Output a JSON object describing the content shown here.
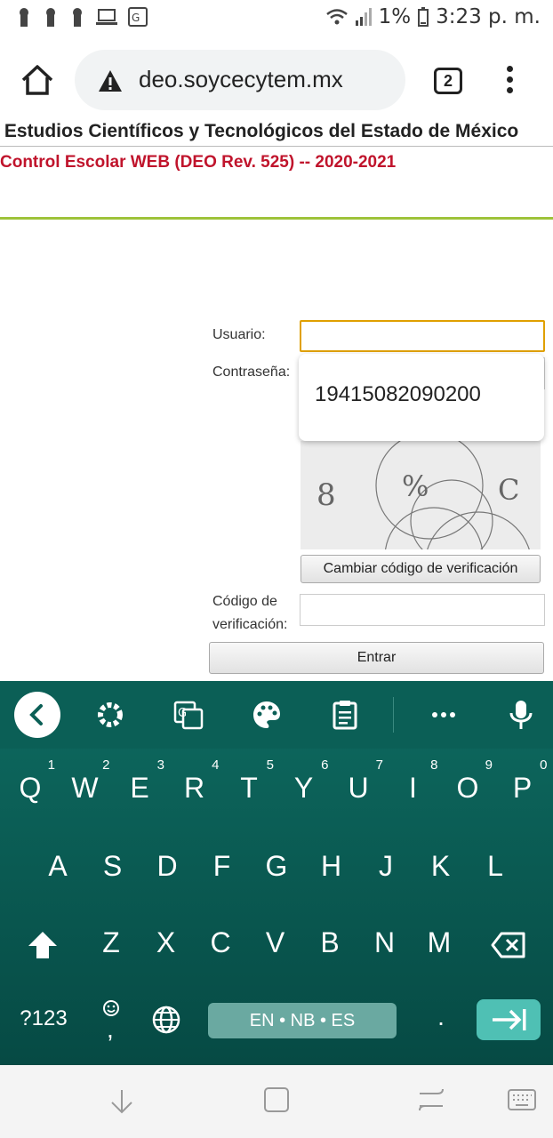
{
  "status_bar": {
    "battery": "1%",
    "time": "3:23 p. m."
  },
  "browser": {
    "url": "deo.soycecytem.mx",
    "tab_count": "2"
  },
  "page": {
    "institution_title": "Estudios Científicos y Tecnológicos del Estado de México",
    "subtitle": "Control Escolar WEB (DEO Rev. 525) -- 2020-2021"
  },
  "form": {
    "user_label": "Usuario:",
    "user_value": "",
    "password_label": "Contraseña:",
    "autocomplete_suggestion": "19415082090200",
    "captcha_text": "8 % C",
    "change_code_label": "Cambiar código de verificación",
    "code_label_line1": "Código de",
    "code_label_line2": "verificación:",
    "code_value": "",
    "submit_label": "Entrar"
  },
  "keyboard": {
    "row1": [
      {
        "k": "Q",
        "n": "1"
      },
      {
        "k": "W",
        "n": "2"
      },
      {
        "k": "E",
        "n": "3"
      },
      {
        "k": "R",
        "n": "4"
      },
      {
        "k": "T",
        "n": "5"
      },
      {
        "k": "Y",
        "n": "6"
      },
      {
        "k": "U",
        "n": "7"
      },
      {
        "k": "I",
        "n": "8"
      },
      {
        "k": "O",
        "n": "9"
      },
      {
        "k": "P",
        "n": "0"
      }
    ],
    "row2": [
      "A",
      "S",
      "D",
      "F",
      "G",
      "H",
      "J",
      "K",
      "L"
    ],
    "row3": [
      "Z",
      "X",
      "C",
      "V",
      "B",
      "N",
      "M"
    ],
    "symbols_label": "?123",
    "comma": ",",
    "period": ".",
    "space_label": "EN • NB • ES",
    "toolbar_icons": [
      "back-icon",
      "gear-icon",
      "translate-icon",
      "palette-icon",
      "clipboard-icon",
      "more-icon",
      "mic-icon"
    ]
  },
  "colors": {
    "subtitle_red": "#c0142c",
    "accent_green": "#9ec33a",
    "keyboard_teal": "#0a5a52",
    "enter_key": "#4fc0b4"
  }
}
